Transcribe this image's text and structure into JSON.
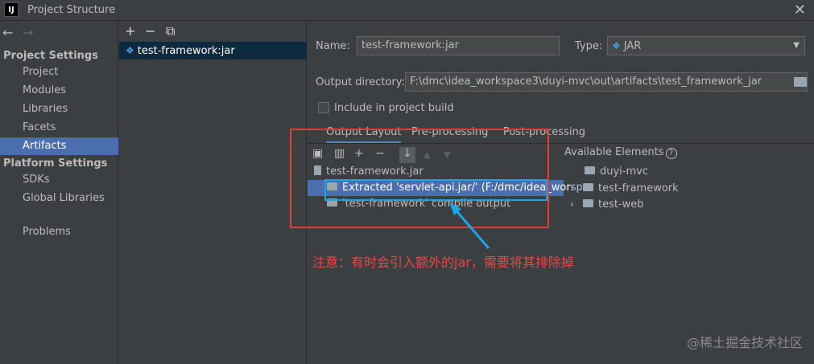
{
  "window": {
    "app_logo": "IJ",
    "title": "Project Structure",
    "close": "✕"
  },
  "nav": {
    "back": "←",
    "forward": "→",
    "sections": [
      {
        "title": "Project Settings",
        "items": [
          "Project",
          "Modules",
          "Libraries",
          "Facets",
          "Artifacts"
        ]
      },
      {
        "title": "Platform Settings",
        "items": [
          "SDKs",
          "Global Libraries"
        ]
      }
    ],
    "problems": "Problems",
    "selected": "Artifacts"
  },
  "artifacts": {
    "toolbar": {
      "add": "+",
      "remove": "−",
      "copy": "⧉"
    },
    "items": [
      "test-framework:jar"
    ]
  },
  "form": {
    "name_label": "Name:",
    "name_value": "test-framework:jar",
    "type_label": "Type:",
    "type_value": "JAR",
    "output_dir_label": "Output directory:",
    "output_dir_value": "F:\\dmc\\idea_workspace3\\duyi-mvc\\out\\artifacts\\test_framework_jar",
    "include_build_label": "Include in project build",
    "include_build_checked": false
  },
  "tabs": {
    "items": [
      "Output Layout",
      "Pre-processing",
      "Post-processing"
    ],
    "active": "Output Layout"
  },
  "layout_toolbar": {
    "add": "+",
    "remove": "−",
    "sort": "↓",
    "up": "▲",
    "down": "▼"
  },
  "output_tree": [
    {
      "label": "test-framework.jar"
    },
    {
      "label": "Extracted 'servlet-api.jar/' (F:/dmc/idea_wor<span>spa</span>"
    },
    {
      "label": "'test-framework' compile output"
    }
  ],
  "available": {
    "label": "Available Elements",
    "help": "?",
    "items": [
      {
        "label": "duyi-mvc"
      },
      {
        "label": "test-framework"
      },
      {
        "label": "test-web"
      }
    ]
  },
  "annotation": {
    "text": "注意：有时会引入额外的jar，需要将其排除掉"
  },
  "watermark": "@稀土掘金技术社区",
  "colors": {
    "background": "#3c3f41",
    "selection": "#4b6eaf",
    "annotation_red": "#e03c3c",
    "annotation_blue": "#1fa3e8"
  }
}
